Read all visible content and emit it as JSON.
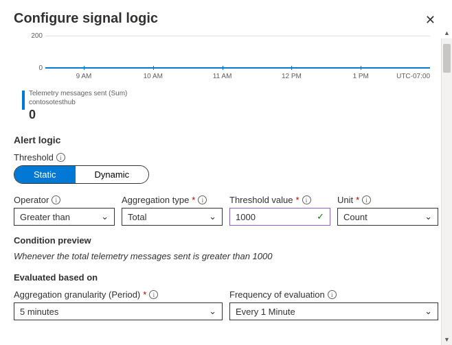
{
  "header": {
    "title": "Configure signal logic"
  },
  "chart_data": {
    "type": "line",
    "x_ticks": [
      "9 AM",
      "10 AM",
      "11 AM",
      "12 PM",
      "1 PM"
    ],
    "y_ticks": [
      0,
      200
    ],
    "timezone": "UTC-07:00",
    "series": [
      {
        "name": "Telemetry messages sent (Sum)",
        "resource": "contosotesthub",
        "value": 0
      }
    ],
    "ylim": [
      0,
      200
    ]
  },
  "legend": {
    "metric": "Telemetry messages sent (Sum)",
    "resource": "contosotesthub",
    "value": "0"
  },
  "alert_logic": {
    "title": "Alert logic",
    "threshold_label": "Threshold",
    "toggle": {
      "static": "Static",
      "dynamic": "Dynamic"
    },
    "operator": {
      "label": "Operator",
      "value": "Greater than"
    },
    "aggregation": {
      "label": "Aggregation type",
      "value": "Total"
    },
    "threshold_value": {
      "label": "Threshold value",
      "value": "1000"
    },
    "unit": {
      "label": "Unit",
      "value": "Count"
    },
    "preview_title": "Condition preview",
    "preview_text": "Whenever the total telemetry messages sent is greater than 1000"
  },
  "evaluated": {
    "title": "Evaluated based on",
    "granularity": {
      "label": "Aggregation granularity (Period)",
      "value": "5 minutes"
    },
    "frequency": {
      "label": "Frequency of evaluation",
      "value": "Every 1 Minute"
    }
  }
}
